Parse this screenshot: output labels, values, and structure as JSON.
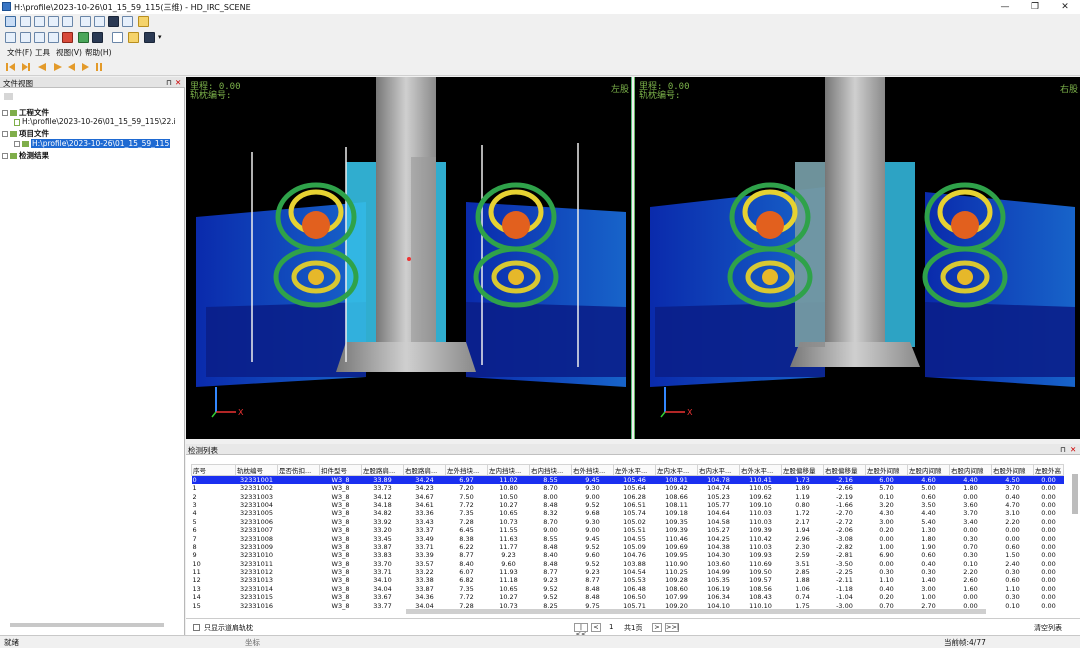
{
  "window": {
    "title": "H:\\profile\\2023-10-26\\01_15_59_115(三维) - HD_IRC_SCENE",
    "minimize": "—",
    "maximize": "❐",
    "close": "✕"
  },
  "menu": [
    "文件(F)",
    "工具",
    "视图(V)",
    "帮助(H)"
  ],
  "file_view": {
    "title": "文件视图",
    "project_file_label": "工程文件",
    "project_file_path": "H:\\profile\\2023-10-26\\01_15_59_115\\22.i",
    "item_file_label": "项目文件",
    "item_file_path": "H:\\profile\\2023-10-26\\01_15_59_115",
    "results_label": "检测结果"
  },
  "views": {
    "left": {
      "mileage": "里程: 0.00",
      "sleeper": "轨枕编号:",
      "side": "左股"
    },
    "right": {
      "mileage": "里程: 0.00",
      "sleeper": "轨枕编号:",
      "side": "右股"
    }
  },
  "list": {
    "title": "检测列表",
    "headers": [
      "序号",
      "轨枕编号",
      "是否伤扣...",
      "扣件型号",
      "左股路肩...",
      "右股路肩...",
      "左外挡块...",
      "左内挡块...",
      "右内挡块...",
      "右外挡块...",
      "左外水平...",
      "左内水平...",
      "右内水平...",
      "右外水平...",
      "左股偏移量",
      "右股偏移量",
      "左股外间隙",
      "左股内间隙",
      "右股内间隙",
      "右股外间隙",
      "左股外高"
    ],
    "rows": [
      [
        "0",
        "32331001",
        "",
        "W3_8",
        "33.89",
        "34.24",
        "6.97",
        "11.02",
        "8.55",
        "9.45",
        "105.46",
        "108.91",
        "104.78",
        "110.41",
        "1.73",
        "-2.16",
        "6.00",
        "4.60",
        "4.40",
        "4.50",
        "0.00"
      ],
      [
        "1",
        "32331002",
        "",
        "W3_8",
        "33.73",
        "34.23",
        "7.20",
        "10.80",
        "8.70",
        "9.30",
        "105.64",
        "109.42",
        "104.74",
        "110.05",
        "1.89",
        "-2.66",
        "5.70",
        "5.00",
        "1.80",
        "3.70",
        "0.00"
      ],
      [
        "2",
        "32331003",
        "",
        "W3_8",
        "34.12",
        "34.67",
        "7.50",
        "10.50",
        "8.00",
        "9.00",
        "106.28",
        "108.66",
        "105.23",
        "109.62",
        "1.19",
        "-2.19",
        "0.10",
        "0.60",
        "0.00",
        "0.40",
        "0.00"
      ],
      [
        "3",
        "32331004",
        "",
        "W3_8",
        "34.18",
        "34.61",
        "7.72",
        "10.27",
        "8.48",
        "9.52",
        "106.51",
        "108.11",
        "105.77",
        "109.10",
        "0.80",
        "-1.66",
        "3.20",
        "3.50",
        "3.60",
        "4.70",
        "0.00"
      ],
      [
        "4",
        "32331005",
        "",
        "W3_8",
        "34.82",
        "33.36",
        "7.35",
        "10.65",
        "8.32",
        "9.68",
        "105.74",
        "109.18",
        "104.64",
        "110.03",
        "1.72",
        "-2.70",
        "4.30",
        "4.40",
        "3.70",
        "3.10",
        "0.00"
      ],
      [
        "5",
        "32331006",
        "",
        "W3_8",
        "33.92",
        "33.43",
        "7.28",
        "10.73",
        "8.70",
        "9.30",
        "105.02",
        "109.35",
        "104.58",
        "110.03",
        "2.17",
        "-2.72",
        "3.00",
        "5.40",
        "3.40",
        "2.20",
        "0.00"
      ],
      [
        "6",
        "32331007",
        "",
        "W3_8",
        "33.20",
        "33.37",
        "6.45",
        "11.55",
        "9.00",
        "9.00",
        "105.51",
        "109.39",
        "105.27",
        "109.39",
        "1.94",
        "-2.06",
        "0.20",
        "1.30",
        "0.00",
        "0.00",
        "0.00"
      ],
      [
        "7",
        "32331008",
        "",
        "W3_8",
        "33.45",
        "33.49",
        "8.38",
        "11.63",
        "8.55",
        "9.45",
        "104.55",
        "110.46",
        "104.25",
        "110.42",
        "2.96",
        "-3.08",
        "0.00",
        "1.80",
        "0.30",
        "0.00",
        "0.00"
      ],
      [
        "8",
        "32331009",
        "",
        "W3_8",
        "33.87",
        "33.71",
        "6.22",
        "11.77",
        "8.48",
        "9.52",
        "105.09",
        "109.69",
        "104.38",
        "110.03",
        "2.30",
        "-2.82",
        "1.00",
        "1.90",
        "0.70",
        "0.60",
        "0.00"
      ],
      [
        "9",
        "32331010",
        "",
        "W3_8",
        "33.83",
        "33.39",
        "8.77",
        "9.23",
        "8.40",
        "9.60",
        "104.76",
        "109.95",
        "104.30",
        "109.93",
        "2.59",
        "-2.81",
        "6.90",
        "0.60",
        "0.30",
        "1.50",
        "0.00"
      ],
      [
        "10",
        "32331011",
        "",
        "W3_8",
        "33.70",
        "33.57",
        "8.40",
        "9.60",
        "8.48",
        "9.52",
        "103.88",
        "110.90",
        "103.60",
        "110.69",
        "3.51",
        "-3.50",
        "0.00",
        "0.40",
        "0.10",
        "2.40",
        "0.00"
      ],
      [
        "11",
        "32331012",
        "",
        "W3_8",
        "33.71",
        "33.22",
        "6.07",
        "11.93",
        "8.77",
        "9.23",
        "104.54",
        "110.25",
        "104.99",
        "109.50",
        "2.85",
        "-2.25",
        "0.30",
        "0.30",
        "2.20",
        "0.30",
        "0.00"
      ],
      [
        "12",
        "32331013",
        "",
        "W3_8",
        "34.10",
        "33.38",
        "6.82",
        "11.18",
        "9.23",
        "8.77",
        "105.53",
        "109.28",
        "105.35",
        "109.57",
        "1.88",
        "-2.11",
        "1.10",
        "1.40",
        "2.60",
        "0.60",
        "0.00"
      ],
      [
        "13",
        "32331014",
        "",
        "W3_8",
        "34.04",
        "33.87",
        "7.35",
        "10.65",
        "9.52",
        "8.48",
        "106.48",
        "108.60",
        "106.19",
        "108.56",
        "1.06",
        "-1.18",
        "0.40",
        "3.00",
        "1.60",
        "1.10",
        "0.00"
      ],
      [
        "14",
        "32331015",
        "",
        "W3_8",
        "33.67",
        "34.36",
        "7.72",
        "10.27",
        "9.52",
        "8.48",
        "106.50",
        "107.99",
        "106.34",
        "108.43",
        "0.74",
        "-1.04",
        "0.20",
        "1.00",
        "0.00",
        "0.30",
        "0.00"
      ],
      [
        "15",
        "32331016",
        "",
        "W3_8",
        "33.77",
        "34.04",
        "7.28",
        "10.73",
        "8.25",
        "9.75",
        "105.71",
        "109.20",
        "104.10",
        "110.10",
        "1.75",
        "-3.00",
        "0.70",
        "2.70",
        "0.00",
        "0.10",
        "0.00"
      ]
    ],
    "show_abnormal_label": "只显示道肩轨枕",
    "pager": {
      "first": "|<<",
      "prev": "<",
      "page": "1",
      "total": "共1页",
      "next": ">",
      "last": ">>|"
    },
    "clear_button": "清空列表"
  },
  "status": {
    "ready": "就绪",
    "coord_label": "坐标",
    "current": "当前帧:4/77"
  }
}
